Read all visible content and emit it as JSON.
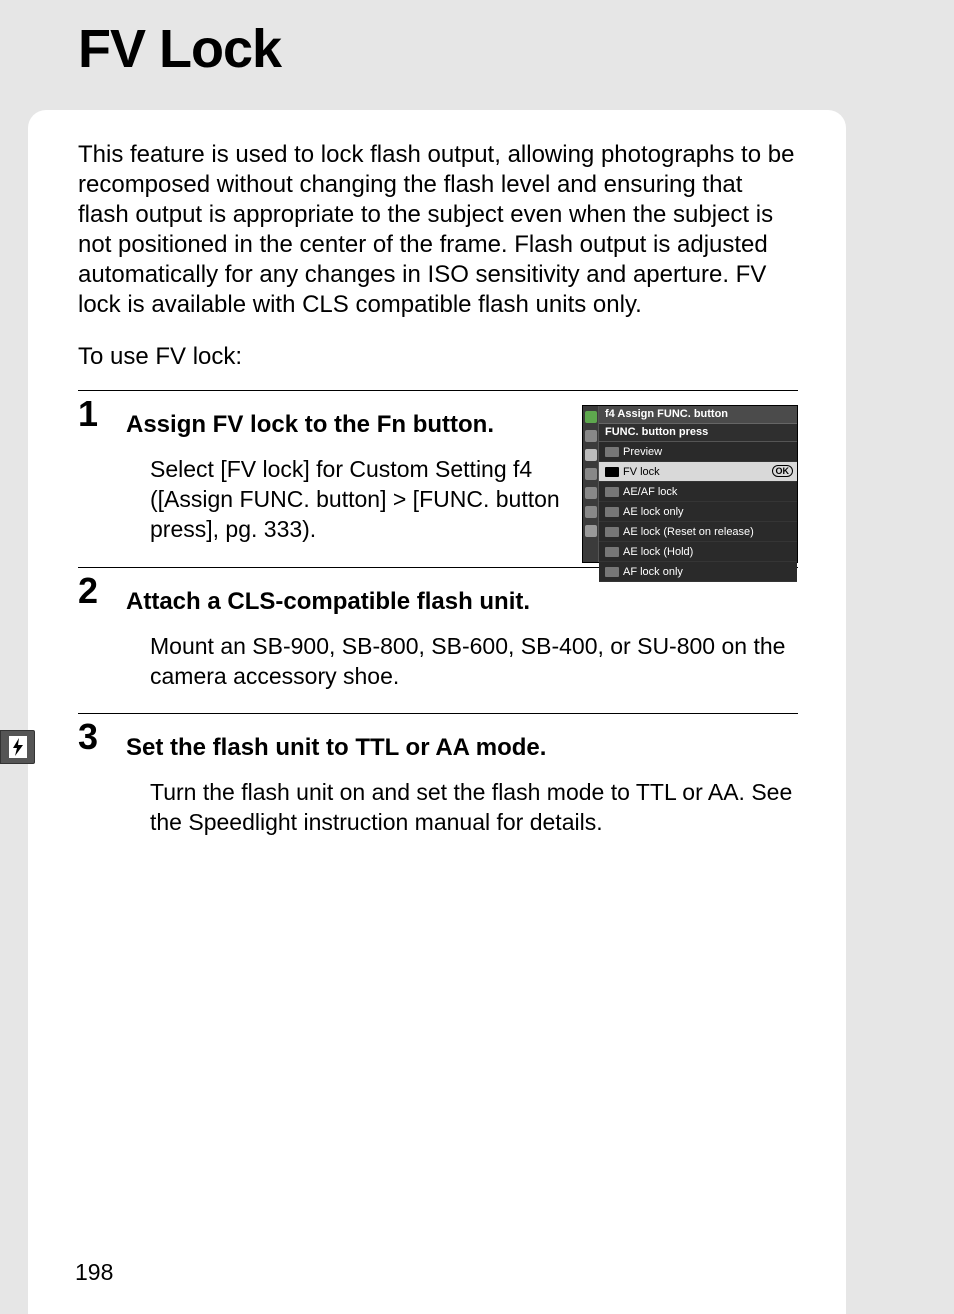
{
  "title": "FV Lock",
  "intro": "This feature is used to lock flash output, allowing photographs to be recomposed without changing the flash level and ensuring that flash output is appropriate to the subject even when the subject is not positioned in the center of the frame.  Flash output is adjusted automatically for any changes in ISO sensitivity and aperture.  FV lock is available with CLS compatible flash units only.",
  "lead": "To use FV lock:",
  "steps": [
    {
      "num": "1",
      "heading_pre": "Assign FV lock to the ",
      "heading_fn": "Fn",
      "heading_post": " button.",
      "body": "Select [FV lock] for Custom Setting f4 ([Assign FUNC.  button] > [FUNC.  button press], pg. 333)."
    },
    {
      "num": "2",
      "heading": "Attach a CLS-compatible flash unit.",
      "body": "Mount an SB-900, SB-800, SB-600, SB-400, or SU-800 on the camera accessory shoe."
    },
    {
      "num": "3",
      "heading": "Set the flash unit to TTL or AA mode.",
      "body": "Turn the flash unit on and set the flash mode to TTL or AA.  See the Speedlight instruction manual for details."
    }
  ],
  "menu": {
    "title1": "f4 Assign FUNC. button",
    "title2": "FUNC. button press",
    "ok": "OK",
    "rows": [
      {
        "label": "Preview",
        "selected": false
      },
      {
        "label": "FV lock",
        "selected": true
      },
      {
        "label": "AE/AF lock",
        "selected": false
      },
      {
        "label": "AE lock only",
        "selected": false
      },
      {
        "label": "AE lock (Reset on release)",
        "selected": false
      },
      {
        "label": "AE lock (Hold)",
        "selected": false
      },
      {
        "label": "AF lock only",
        "selected": false
      }
    ]
  },
  "page_number": "198"
}
